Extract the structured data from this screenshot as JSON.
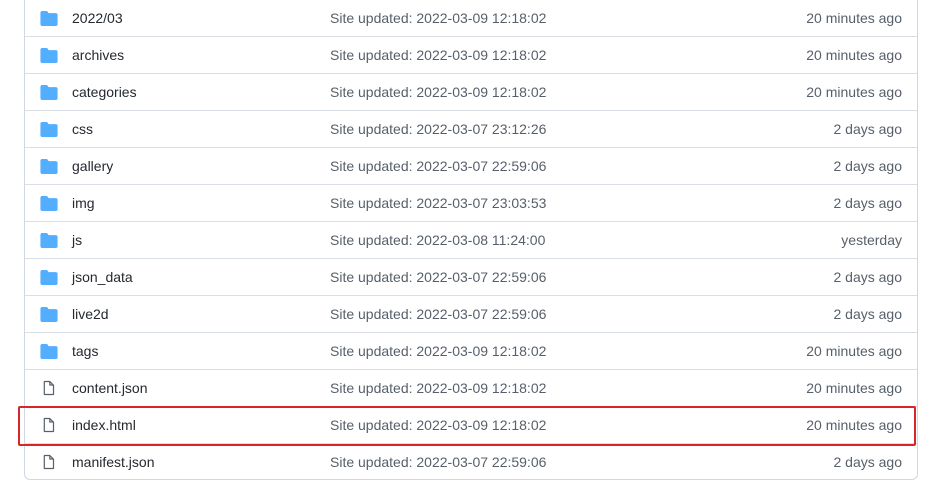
{
  "colors": {
    "folder": "#54aeff",
    "file": "#57606a",
    "highlight": "#d7262b",
    "text_muted": "#57606a"
  },
  "rows": [
    {
      "type": "folder",
      "icon": "folder-icon",
      "name_prefix": "2022/",
      "name": "03",
      "message": "Site updated: 2022-03-09 12:18:02",
      "age": "20 minutes ago"
    },
    {
      "type": "folder",
      "icon": "folder-icon",
      "name": "archives",
      "message": "Site updated: 2022-03-09 12:18:02",
      "age": "20 minutes ago"
    },
    {
      "type": "folder",
      "icon": "folder-icon",
      "name": "categories",
      "message": "Site updated: 2022-03-09 12:18:02",
      "age": "20 minutes ago"
    },
    {
      "type": "folder",
      "icon": "folder-icon",
      "name": "css",
      "message": "Site updated: 2022-03-07 23:12:26",
      "age": "2 days ago"
    },
    {
      "type": "folder",
      "icon": "folder-icon",
      "name": "gallery",
      "message": "Site updated: 2022-03-07 22:59:06",
      "age": "2 days ago"
    },
    {
      "type": "folder",
      "icon": "folder-icon",
      "name": "img",
      "message": "Site updated: 2022-03-07 23:03:53",
      "age": "2 days ago"
    },
    {
      "type": "folder",
      "icon": "folder-icon",
      "name": "js",
      "message": "Site updated: 2022-03-08 11:24:00",
      "age": "yesterday"
    },
    {
      "type": "folder",
      "icon": "folder-icon",
      "name": "json_data",
      "message": "Site updated: 2022-03-07 22:59:06",
      "age": "2 days ago"
    },
    {
      "type": "folder",
      "icon": "folder-icon",
      "name": "live2d",
      "message": "Site updated: 2022-03-07 22:59:06",
      "age": "2 days ago"
    },
    {
      "type": "folder",
      "icon": "folder-icon",
      "name": "tags",
      "message": "Site updated: 2022-03-09 12:18:02",
      "age": "20 minutes ago"
    },
    {
      "type": "file",
      "icon": "file-icon",
      "name": "content.json",
      "message": "Site updated: 2022-03-09 12:18:02",
      "age": "20 minutes ago"
    },
    {
      "type": "file",
      "icon": "file-icon",
      "name": "index.html",
      "message": "Site updated: 2022-03-09 12:18:02",
      "age": "20 minutes ago"
    },
    {
      "type": "file",
      "icon": "file-icon",
      "name": "manifest.json",
      "message": "Site updated: 2022-03-07 22:59:06",
      "age": "2 days ago"
    }
  ]
}
